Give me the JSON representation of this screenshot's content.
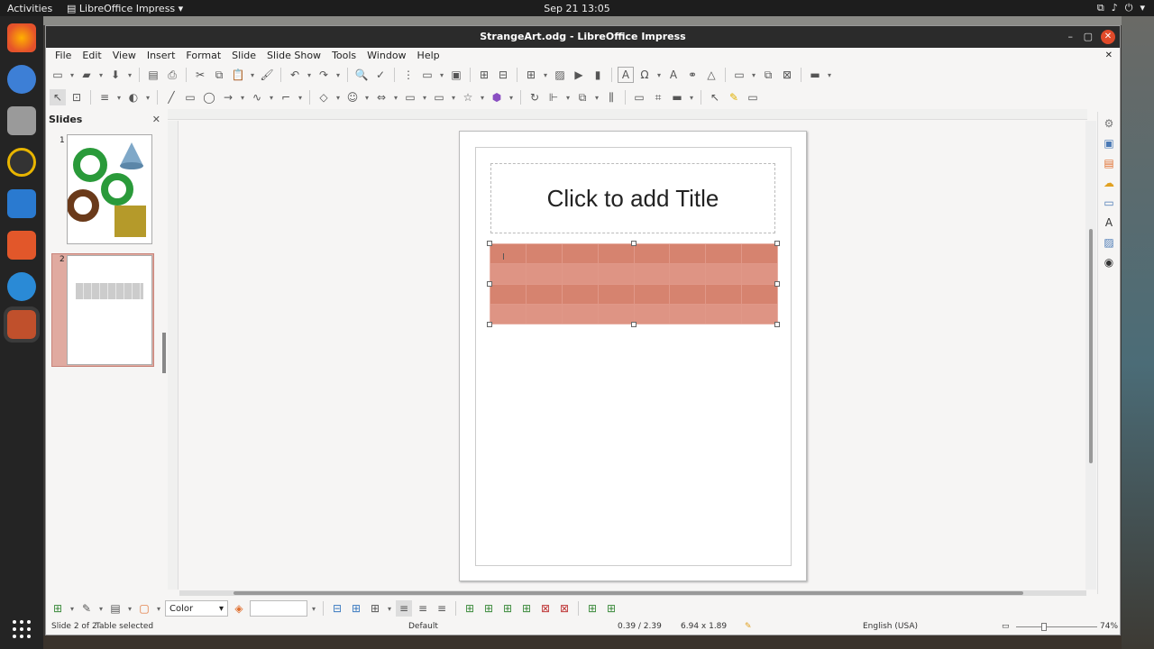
{
  "topbar": {
    "activities": "Activities",
    "app": "LibreOffice Impress",
    "clock": "Sep 21  13:05"
  },
  "window": {
    "title": "StrangeArt.odg - LibreOffice Impress"
  },
  "menu": [
    "File",
    "Edit",
    "View",
    "Insert",
    "Format",
    "Slide",
    "Slide Show",
    "Tools",
    "Window",
    "Help"
  ],
  "slides_panel": {
    "header": "Slides",
    "slide1_num": "1",
    "slide2_num": "2"
  },
  "slide": {
    "title_placeholder": "Click to add Title"
  },
  "bottom_toolbar": {
    "area_fill": "Color"
  },
  "status": {
    "slide": "Slide 2 of 2",
    "selection": "Table selected",
    "layout": "Default",
    "position": "0.39 / 2.39",
    "size": "6.94 x 1.89",
    "language": "English (USA)",
    "zoom": "74%"
  },
  "colors": {
    "table_fill": "#e09888",
    "selection": "#e8a89c",
    "titlebar": "#2b2b2b"
  }
}
